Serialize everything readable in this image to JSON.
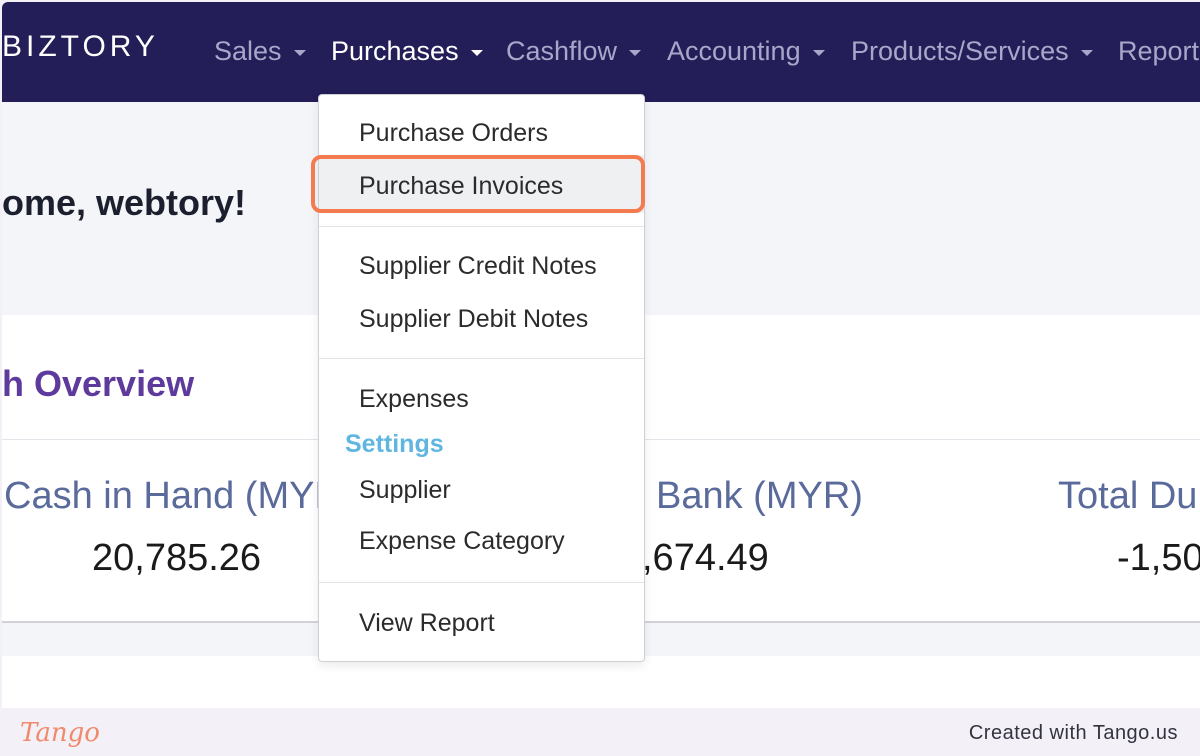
{
  "navbar": {
    "brand": "BIZTORY",
    "items": [
      {
        "label": "Sales"
      },
      {
        "label": "Purchases"
      },
      {
        "label": "Cashflow"
      },
      {
        "label": "Accounting"
      },
      {
        "label": "Products/Services"
      },
      {
        "label": "Reports"
      }
    ],
    "active": "Purchases"
  },
  "welcome": "ome, webtory!",
  "overview": {
    "title": "h Overview",
    "stats": [
      {
        "label": "Cash in Hand (MYR)",
        "value": "20,785.26"
      },
      {
        "label": "Bank (MYR)",
        "value": ",674.49"
      },
      {
        "label": "Total Du",
        "value": "-1,50"
      }
    ]
  },
  "purchases_menu": {
    "items": [
      {
        "label": "Purchase Orders"
      },
      {
        "label": "Purchase Invoices",
        "highlighted": true
      },
      {
        "label": "Supplier Credit Notes"
      },
      {
        "label": "Supplier Debit Notes"
      },
      {
        "label": "Expenses"
      }
    ],
    "settings_header": "Settings",
    "settings_items": [
      {
        "label": "Supplier"
      },
      {
        "label": "Expense Category"
      }
    ],
    "report_item": "View Report"
  },
  "footer": {
    "logo": "Tango",
    "created_with": "Created with Tango.us"
  },
  "colors": {
    "navbar_bg": "#231d58",
    "focus_ring": "#f47a4f",
    "overview_title": "#5e3a9c",
    "settings_header": "#5fb6e0"
  }
}
